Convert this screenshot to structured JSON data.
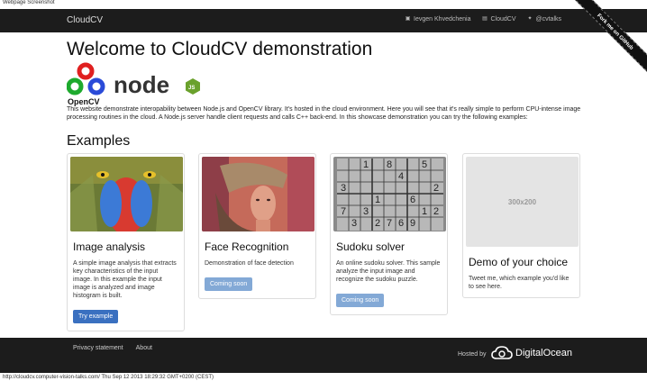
{
  "screenshot": {
    "title": "Webpage Screenshot",
    "footer": "http://cloudcv.computer-vision-talks.com/ Thu Sep 12 2013 18:29:32 GMT+0200 (CEST)"
  },
  "navbar": {
    "brand": "CloudCV",
    "links": [
      {
        "icon": "linkedin-icon",
        "label": "Ievgen Khvedchenia"
      },
      {
        "icon": "github-icon",
        "label": "CloudCV"
      },
      {
        "icon": "twitter-icon",
        "label": "@cvtalks"
      }
    ],
    "ribbon": "Fork me on GitHub"
  },
  "page": {
    "title": "Welcome to CloudCV demonstration",
    "logos": {
      "opencv": "OpenCV",
      "node": "node"
    },
    "intro": "This website demonstrate interopability between Node.js and OpenCV library. It's hosted in the cloud environment. Here you will see that it's really simple to perform CPU-intense image processing routines in the cloud. A Node.js server handle client requests and calls C++ back-end. In this showcase demonstration you can try the following examples:",
    "examples_heading": "Examples"
  },
  "cards": [
    {
      "title": "Image analysis",
      "text": "A simple image analysis that extracts key characteristics of the input image. In this example the input image is analyzed and image histogram is built.",
      "button": "Try example"
    },
    {
      "title": "Face Recognition",
      "text": "Demonstration of face detection",
      "button": "Coming soon"
    },
    {
      "title": "Sudoku solver",
      "text": "An online sudoku solver. This sample analyze the input image and recognize the sudoku puzzle.",
      "button": "Coming soon"
    },
    {
      "title": "Demo of your choice",
      "text": "Tweet me, which example you'd like to see here.",
      "placeholder": "300x200"
    }
  ],
  "sudoku_digits": [
    "1",
    "8",
    "5",
    "4",
    "3",
    "2",
    "1",
    "6",
    "7",
    "3",
    "1",
    "2",
    "3",
    "2",
    "7",
    "6",
    "9"
  ],
  "footer": {
    "links": [
      "Privacy statement",
      "About"
    ],
    "hosted_by": "Hosted by",
    "host_name": "DigitalOcean"
  },
  "colors": {
    "navbar": "#1c1c1c",
    "primary_button": "#3a70c0",
    "disabled_button": "#83a9d6"
  }
}
